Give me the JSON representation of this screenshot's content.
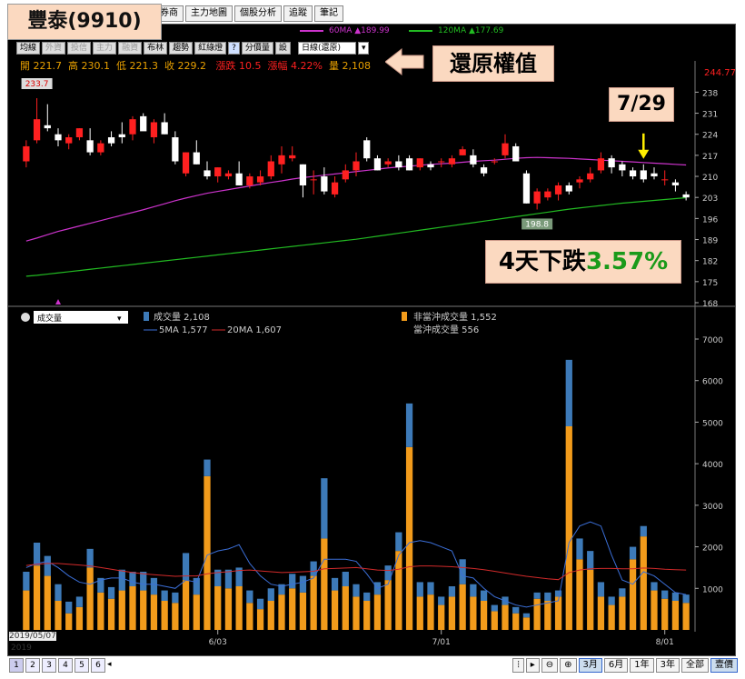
{
  "title_box": "豐泰(9910)",
  "tabs": [
    "券商",
    "主力地圖",
    "個股分析",
    "追蹤",
    "筆記"
  ],
  "toolbar": {
    "buttons": [
      "均線",
      "外資",
      "投信",
      "主力",
      "融資",
      "布林",
      "趨勢",
      "紅綠燈",
      "?",
      "分價量",
      "設"
    ],
    "period_select": "日線(還原)"
  },
  "ma_legend": [
    {
      "label": "60MA ▲189.99",
      "color": "#cc33cc"
    },
    {
      "label": "120MA ▲177.69",
      "color": "#22bb22"
    }
  ],
  "ohlc": {
    "open": "開 221.7",
    "high": "高 230.1",
    "low": "低 221.3",
    "close": "收 229.2",
    "change": "漲跌 10.5",
    "pct": "漲幅 4.22%",
    "volume": "量 2,108"
  },
  "price_right_label": "244.77",
  "callouts": {
    "restore": "還原權值",
    "date": "7/29",
    "drop_prefix": "4天下跌",
    "drop_pct": "3.57%"
  },
  "volume_panel": {
    "select": "成交量",
    "legend1": "成交量 2,108",
    "legend_ma5": "5MA 1,577",
    "legend_ma20": "20MA 1,607",
    "legend_nonday": "非當沖成交量 1,552",
    "legend_day": "當沖成交量 556"
  },
  "footer": {
    "start_date": "2019/05/07",
    "year": "2019",
    "pages": [
      "1",
      "2",
      "3",
      "4",
      "5",
      "6"
    ],
    "ranges": [
      "3月",
      "6月",
      "1年",
      "3年",
      "全部",
      "壹價"
    ],
    "selected_range": "3月"
  },
  "colors": {
    "up": "#ff2020",
    "down": "#ffffff",
    "ma60": "#cc33cc",
    "ma120": "#22bb22",
    "vol_day": "#3d7ab8",
    "vol_nonday": "#f29b1b",
    "ma5": "#3b6fd8",
    "ma20": "#d12a2a"
  },
  "chart_data": [
    {
      "type": "candlestick",
      "ylim": [
        168,
        244.77
      ],
      "yticks": [
        168,
        175,
        182,
        189,
        196,
        203,
        210,
        217,
        224,
        231,
        238
      ],
      "xticks": [
        "6/03",
        "7/01",
        "8/01"
      ],
      "annotations": {
        "high": "233.7",
        "low": "198.8"
      },
      "candles": [
        {
          "o": 215,
          "h": 222,
          "l": 213,
          "c": 220
        },
        {
          "o": 222,
          "h": 236,
          "l": 221,
          "c": 229
        },
        {
          "o": 227,
          "h": 234,
          "l": 225,
          "c": 226
        },
        {
          "o": 224,
          "h": 226,
          "l": 220,
          "c": 222
        },
        {
          "o": 221,
          "h": 224,
          "l": 219,
          "c": 223
        },
        {
          "o": 223,
          "h": 226,
          "l": 222,
          "c": 226
        },
        {
          "o": 222,
          "h": 226,
          "l": 217,
          "c": 218
        },
        {
          "o": 218,
          "h": 222,
          "l": 217,
          "c": 221
        },
        {
          "o": 223,
          "h": 225,
          "l": 220,
          "c": 221
        },
        {
          "o": 224,
          "h": 228,
          "l": 221,
          "c": 223
        },
        {
          "o": 224,
          "h": 230,
          "l": 222,
          "c": 229
        },
        {
          "o": 230,
          "h": 231,
          "l": 226,
          "c": 225
        },
        {
          "o": 223,
          "h": 229,
          "l": 221,
          "c": 228
        },
        {
          "o": 228,
          "h": 231,
          "l": 224,
          "c": 224
        },
        {
          "o": 223,
          "h": 225,
          "l": 214,
          "c": 215
        },
        {
          "o": 211,
          "h": 218,
          "l": 210,
          "c": 218
        },
        {
          "o": 218,
          "h": 222,
          "l": 214,
          "c": 214
        },
        {
          "o": 212,
          "h": 215,
          "l": 209,
          "c": 210
        },
        {
          "o": 210,
          "h": 213,
          "l": 208,
          "c": 213
        },
        {
          "o": 210,
          "h": 212,
          "l": 209,
          "c": 211
        },
        {
          "o": 211,
          "h": 215,
          "l": 207,
          "c": 207
        },
        {
          "o": 207,
          "h": 211,
          "l": 206,
          "c": 210
        },
        {
          "o": 208,
          "h": 212,
          "l": 207,
          "c": 210
        },
        {
          "o": 210,
          "h": 217,
          "l": 209,
          "c": 215
        },
        {
          "o": 214,
          "h": 220,
          "l": 211,
          "c": 217
        },
        {
          "o": 216,
          "h": 220,
          "l": 215,
          "c": 217
        },
        {
          "o": 214,
          "h": 214,
          "l": 203,
          "c": 207
        },
        {
          "o": 209,
          "h": 212,
          "l": 204,
          "c": 209
        },
        {
          "o": 210,
          "h": 213,
          "l": 204,
          "c": 205
        },
        {
          "o": 204,
          "h": 210,
          "l": 203,
          "c": 208
        },
        {
          "o": 209,
          "h": 214,
          "l": 208,
          "c": 212
        },
        {
          "o": 212,
          "h": 218,
          "l": 210,
          "c": 215
        },
        {
          "o": 222,
          "h": 223,
          "l": 215,
          "c": 216
        },
        {
          "o": 216,
          "h": 217,
          "l": 212,
          "c": 212
        },
        {
          "o": 214,
          "h": 216,
          "l": 213,
          "c": 215
        },
        {
          "o": 215,
          "h": 217,
          "l": 212,
          "c": 213
        },
        {
          "o": 216,
          "h": 217,
          "l": 212,
          "c": 212
        },
        {
          "o": 213,
          "h": 216,
          "l": 212,
          "c": 216
        },
        {
          "o": 214,
          "h": 215,
          "l": 212,
          "c": 213
        },
        {
          "o": 215,
          "h": 216,
          "l": 213,
          "c": 215
        },
        {
          "o": 214,
          "h": 217,
          "l": 213,
          "c": 216
        },
        {
          "o": 217,
          "h": 220,
          "l": 217,
          "c": 219
        },
        {
          "o": 217,
          "h": 219,
          "l": 213,
          "c": 214
        },
        {
          "o": 213,
          "h": 214,
          "l": 210,
          "c": 211
        },
        {
          "o": 215,
          "h": 216,
          "l": 214,
          "c": 215
        },
        {
          "o": 217,
          "h": 224,
          "l": 216,
          "c": 221
        },
        {
          "o": 220,
          "h": 221,
          "l": 215,
          "c": 215
        },
        {
          "o": 211,
          "h": 212,
          "l": 201,
          "c": 201
        },
        {
          "o": 201,
          "h": 206,
          "l": 199,
          "c": 205
        },
        {
          "o": 203,
          "h": 206,
          "l": 202,
          "c": 205
        },
        {
          "o": 204,
          "h": 208,
          "l": 202,
          "c": 207
        },
        {
          "o": 207,
          "h": 208,
          "l": 204,
          "c": 205
        },
        {
          "o": 208,
          "h": 210,
          "l": 206,
          "c": 209
        },
        {
          "o": 209,
          "h": 213,
          "l": 208,
          "c": 211
        },
        {
          "o": 212,
          "h": 218,
          "l": 211,
          "c": 216
        },
        {
          "o": 216,
          "h": 217,
          "l": 211,
          "c": 213
        },
        {
          "o": 214,
          "h": 215,
          "l": 210,
          "c": 212
        },
        {
          "o": 212,
          "h": 213,
          "l": 209,
          "c": 210
        },
        {
          "o": 212,
          "h": 214,
          "l": 208,
          "c": 209
        },
        {
          "o": 211,
          "h": 213,
          "l": 209,
          "c": 210
        },
        {
          "o": 209,
          "h": 212,
          "l": 207,
          "c": 209
        },
        {
          "o": 208,
          "h": 209,
          "l": 205,
          "c": 207
        },
        {
          "o": 204,
          "h": 205,
          "l": 202,
          "c": 203
        }
      ],
      "series": [
        {
          "name": "60MA",
          "values": [
            188.5,
            189.5,
            190.6,
            191.7,
            192.6,
            193.5,
            194.4,
            195.3,
            196.2,
            197.1,
            198,
            198.9,
            199.9,
            200.9,
            201.9,
            202.8,
            203.6,
            204.4,
            205,
            205.6,
            206.2,
            206.8,
            207.4,
            208,
            208.5,
            209.1,
            209.6,
            210,
            210.4,
            210.8,
            211.2,
            211.6,
            212,
            212.4,
            212.8,
            213.1,
            213.4,
            213.7,
            214,
            214.2,
            214.4,
            214.7,
            215,
            215.2,
            215.4,
            215.7,
            216,
            216.2,
            216.3,
            216.2,
            216.1,
            216,
            215.8,
            215.6,
            215.4,
            215.2,
            215,
            214.8,
            214.6,
            214.4,
            214.2,
            214,
            213.8
          ]
        },
        {
          "name": "120MA",
          "values": [
            176.8,
            177.1,
            177.5,
            177.9,
            178.3,
            178.7,
            179.1,
            179.5,
            179.9,
            180.3,
            180.7,
            181.1,
            181.5,
            181.9,
            182.3,
            182.7,
            183.1,
            183.5,
            183.9,
            184.3,
            184.7,
            185.1,
            185.5,
            185.9,
            186.3,
            186.7,
            187.1,
            187.5,
            187.9,
            188.3,
            188.7,
            189.1,
            189.6,
            190.1,
            190.6,
            191.1,
            191.6,
            192.1,
            192.6,
            193.1,
            193.6,
            194.1,
            194.6,
            195.1,
            195.6,
            196.1,
            196.6,
            197.1,
            197.6,
            198.1,
            198.6,
            199.1,
            199.5,
            199.9,
            200.3,
            200.7,
            201.1,
            201.4,
            201.7,
            202,
            202.3,
            202.6,
            202.9
          ]
        }
      ]
    },
    {
      "type": "bar",
      "ylim": [
        0,
        7000
      ],
      "yticks": [
        1000,
        2000,
        3000,
        4000,
        5000,
        6000,
        7000
      ],
      "series": [
        {
          "name": "非當沖成交量",
          "values": [
            950,
            1550,
            1300,
            700,
            400,
            550,
            1500,
            900,
            750,
            950,
            1050,
            950,
            850,
            700,
            650,
            1200,
            850,
            3700,
            1050,
            1000,
            1050,
            650,
            500,
            700,
            850,
            1000,
            900,
            1300,
            2200,
            950,
            1050,
            800,
            700,
            850,
            1200,
            1900,
            4400,
            800,
            850,
            600,
            800,
            1100,
            800,
            700,
            450,
            600,
            400,
            300,
            750,
            700,
            800,
            4900,
            1700,
            1450,
            800,
            600,
            800,
            1700,
            2250,
            950,
            750,
            700,
            650,
            500,
            700,
            800
          ]
        },
        {
          "name": "當沖成交量",
          "values": [
            450,
            550,
            480,
            400,
            280,
            250,
            450,
            350,
            280,
            500,
            350,
            450,
            400,
            250,
            250,
            650,
            400,
            400,
            400,
            450,
            450,
            300,
            250,
            300,
            250,
            350,
            400,
            350,
            1450,
            300,
            350,
            300,
            200,
            300,
            350,
            450,
            1050,
            350,
            300,
            200,
            250,
            600,
            300,
            250,
            150,
            200,
            150,
            100,
            150,
            200,
            150,
            1600,
            500,
            450,
            350,
            200,
            200,
            300,
            250,
            200,
            200,
            200,
            200,
            150,
            200,
            70
          ]
        },
        {
          "name": "5MA",
          "values": [
            1500,
            1600,
            1650,
            1500,
            1300,
            1150,
            1100,
            1200,
            1250,
            1250,
            1150,
            1100,
            1100,
            1050,
            1000,
            1200,
            1150,
            1800,
            1900,
            1950,
            2050,
            1600,
            1300,
            1100,
            1050,
            1100,
            1150,
            1250,
            1700,
            1700,
            1700,
            1650,
            1350,
            1000,
            1100,
            1800,
            2100,
            2150,
            2100,
            2000,
            1900,
            1300,
            1250,
            1000,
            800,
            700,
            600,
            550,
            600,
            650,
            700,
            2100,
            2500,
            2600,
            2500,
            1800,
            1200,
            1100,
            1400,
            1300,
            1100,
            900,
            850,
            750,
            780
          ]
        },
        {
          "name": "20MA",
          "values": [
            1550,
            1580,
            1600,
            1600,
            1580,
            1560,
            1540,
            1500,
            1460,
            1420,
            1380,
            1350,
            1330,
            1310,
            1290,
            1300,
            1300,
            1350,
            1380,
            1400,
            1430,
            1440,
            1420,
            1400,
            1380,
            1390,
            1400,
            1410,
            1470,
            1480,
            1490,
            1500,
            1470,
            1440,
            1430,
            1460,
            1520,
            1540,
            1540,
            1530,
            1520,
            1500,
            1480,
            1450,
            1410,
            1370,
            1330,
            1290,
            1260,
            1230,
            1210,
            1380,
            1440,
            1470,
            1480,
            1480,
            1470,
            1470,
            1490,
            1480,
            1460,
            1450,
            1440,
            1430,
            1440
          ]
        }
      ]
    }
  ]
}
